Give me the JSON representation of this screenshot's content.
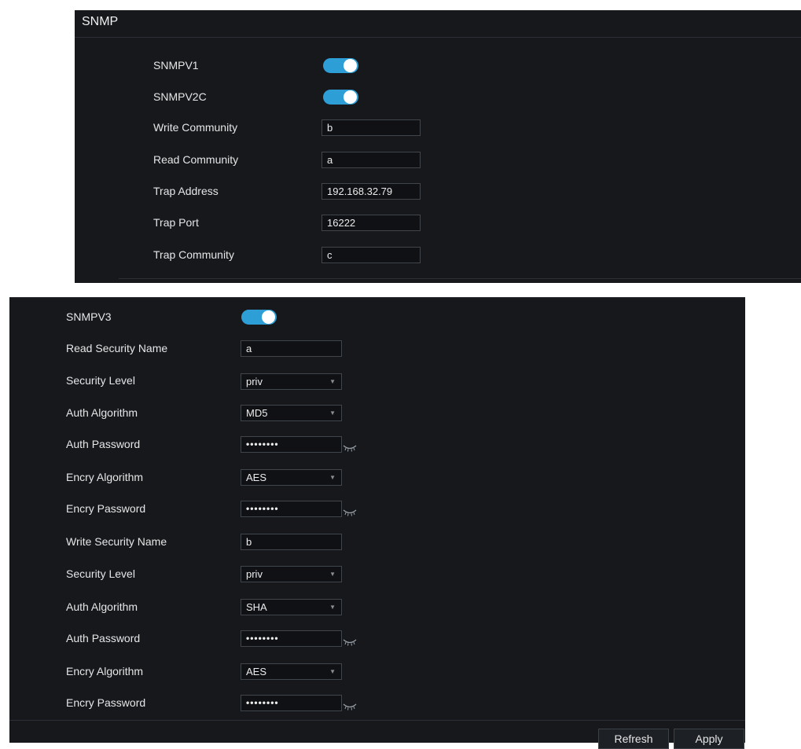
{
  "snmp": {
    "title": "SNMP",
    "snmpv1": {
      "label": "SNMPV1",
      "enabled": true
    },
    "snmpv2c": {
      "label": "SNMPV2C",
      "enabled": true
    },
    "write_community": {
      "label": "Write Community",
      "value": "b"
    },
    "read_community": {
      "label": "Read Community",
      "value": "a"
    },
    "trap_address": {
      "label": "Trap Address",
      "value": "192.168.32.79"
    },
    "trap_port": {
      "label": "Trap Port",
      "value": "16222"
    },
    "trap_community": {
      "label": "Trap Community",
      "value": "c"
    }
  },
  "snmpv3": {
    "toggle": {
      "label": "SNMPV3",
      "enabled": true
    },
    "read_security_name": {
      "label": "Read Security Name",
      "value": "a"
    },
    "read_security_level": {
      "label": "Security Level",
      "value": "priv"
    },
    "read_auth_algorithm": {
      "label": "Auth Algorithm",
      "value": "MD5"
    },
    "read_auth_password": {
      "label": "Auth Password",
      "value": "••••••••"
    },
    "read_encry_algorithm": {
      "label": "Encry Algorithm",
      "value": "AES"
    },
    "read_encry_password": {
      "label": "Encry Password",
      "value": "••••••••"
    },
    "write_security_name": {
      "label": "Write Security Name",
      "value": "b"
    },
    "write_security_level": {
      "label": "Security Level",
      "value": "priv"
    },
    "write_auth_algorithm": {
      "label": "Auth Algorithm",
      "value": "SHA"
    },
    "write_auth_password": {
      "label": "Auth Password",
      "value": "••••••••"
    },
    "write_encry_algorithm": {
      "label": "Encry Algorithm",
      "value": "AES"
    },
    "write_encry_password": {
      "label": "Encry Password",
      "value": "••••••••"
    }
  },
  "buttons": {
    "refresh": "Refresh",
    "apply": "Apply"
  },
  "icons": {
    "dropdown": "chevron-down-icon",
    "password_visibility": "eye-closed-icon"
  },
  "colors": {
    "accent": "#2e9fd6",
    "panel_bg": "#16181c",
    "field_bg": "#101114"
  }
}
